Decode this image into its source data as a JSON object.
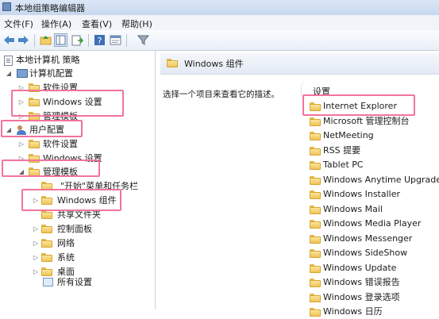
{
  "window": {
    "title": "本地组策略编辑器"
  },
  "menu": [
    "文件(F)",
    "操作(A)",
    "查看(V)",
    "帮助(H)"
  ],
  "toolbar": [
    "back-icon",
    "forward-icon",
    "up-folder-icon",
    "show-hide-tree-icon",
    "export-icon",
    "help-icon",
    "properties-icon",
    "filter-icon"
  ],
  "tree": {
    "root": "本地计算机 策略",
    "computer_config": "计算机配置",
    "cc_software": "软件设置",
    "cc_windows": "Windows 设置",
    "cc_admin": "管理模板",
    "user_config": "用户配置",
    "uc_software": "软件设置",
    "uc_windows": "Windows 设置",
    "uc_admin": "管理模板",
    "start_menu": "\"开始\"菜单和任务栏",
    "windows_components": "Windows 组件",
    "shared_folders": "共享文件夹",
    "control_panel": "控制面板",
    "network": "网络",
    "system": "系统",
    "desktop": "桌面",
    "all_settings": "所有设置"
  },
  "right": {
    "header": "Windows 组件",
    "description": "选择一个项目来查看它的描述。",
    "column": "设置",
    "items": [
      "Internet Explorer",
      "Microsoft 管理控制台",
      "NetMeeting",
      "RSS 提要",
      "Tablet PC",
      "Windows Anytime Upgrade",
      "Windows Installer",
      "Windows Mail",
      "Windows Media Player",
      "Windows Messenger",
      "Windows SideShow",
      "Windows Update",
      "Windows 错误报告",
      "Windows 登录选项",
      "Windows 日历"
    ]
  },
  "highlight_color": "#f2739e"
}
